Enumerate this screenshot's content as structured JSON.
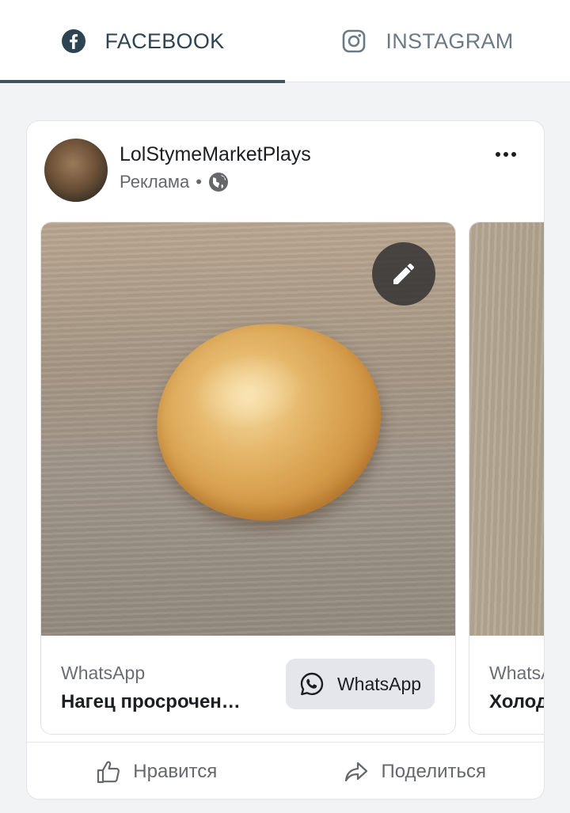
{
  "tabs": [
    {
      "label": "FACEBOOK",
      "icon": "facebook-icon",
      "active": true
    },
    {
      "label": "INSTAGRAM",
      "icon": "instagram-icon",
      "active": false
    }
  ],
  "post": {
    "page_name": "LolStymeMarketPlays",
    "sponsored_label": "Реклама",
    "separator": "•",
    "privacy_icon": "globe-icon",
    "more_icon": "more-options-icon"
  },
  "carousel": {
    "items": [
      {
        "source": "WhatsApp",
        "title": "Нагец просрочен…",
        "cta_label": "WhatsApp",
        "cta_icon": "whatsapp-icon",
        "edit_icon": "pencil-icon"
      },
      {
        "source": "WhatsA",
        "title": "Холод"
      }
    ]
  },
  "actions": {
    "like_label": "Нравится",
    "share_label": "Поделиться"
  },
  "colors": {
    "active_tab_indicator": "#3d5360",
    "background": "#f2f3f5",
    "cta_background": "#e4e6eb"
  }
}
